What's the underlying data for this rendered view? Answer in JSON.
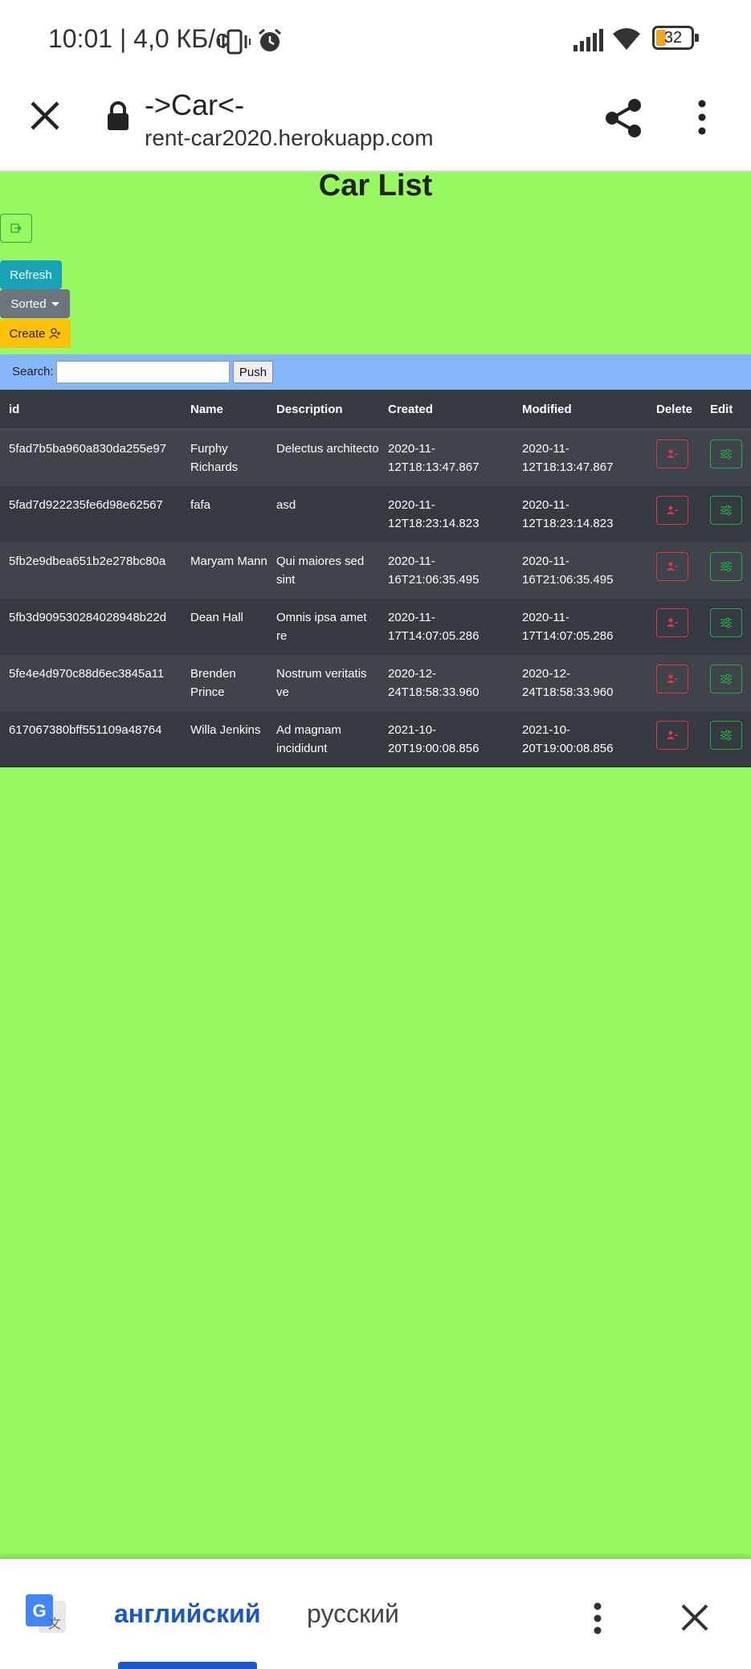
{
  "status_bar": {
    "time": "10:01 | 4,0 КБ/с",
    "battery": "32"
  },
  "browser": {
    "title": "->Car<-",
    "url": "rent-car2020.herokuapp.com"
  },
  "page": {
    "title": "Car List",
    "refresh_label": "Refresh",
    "sorted_label": "Sorted",
    "create_label": "Create"
  },
  "search": {
    "label": "Search:",
    "value": "",
    "push_label": "Push"
  },
  "table": {
    "headers": [
      "id",
      "Name",
      "Description",
      "Created",
      "Modified",
      "Delete",
      "Edit"
    ],
    "rows": [
      {
        "id": "5fad7b5ba960a830da255e97",
        "name": "Furphy Richards",
        "description": "Delectus architecto",
        "created": "2020-11-12T18:13:47.867",
        "modified": "2020-11-12T18:13:47.867"
      },
      {
        "id": "5fad7d922235fe6d98e62567",
        "name": "fafa",
        "description": "asd",
        "created": "2020-11-12T18:23:14.823",
        "modified": "2020-11-12T18:23:14.823"
      },
      {
        "id": "5fb2e9dbea651b2e278bc80a",
        "name": "Maryam Mann",
        "description": "Qui maiores sed sint",
        "created": "2020-11-16T21:06:35.495",
        "modified": "2020-11-16T21:06:35.495"
      },
      {
        "id": "5fb3d909530284028948b22d",
        "name": "Dean Hall",
        "description": "Omnis ipsa amet re",
        "created": "2020-11-17T14:07:05.286",
        "modified": "2020-11-17T14:07:05.286"
      },
      {
        "id": "5fe4e4d970c88d6ec3845a11",
        "name": "Brenden Prince",
        "description": "Nostrum veritatis ve",
        "created": "2020-12-24T18:58:33.960",
        "modified": "2020-12-24T18:58:33.960"
      },
      {
        "id": "617067380bff551109a48764",
        "name": "Willa Jenkins",
        "description": "Ad magnam incididunt",
        "created": "2021-10-20T19:00:08.856",
        "modified": "2021-10-20T19:00:08.856"
      }
    ]
  },
  "translate_bar": {
    "source_lang": "английский",
    "target_lang": "русский"
  },
  "colors": {
    "page_bg": "#98f860",
    "search_bg": "#86b6fa",
    "table_dark": "#343a40",
    "danger": "#dc3545",
    "success": "#28a745",
    "info": "#17a2b8",
    "warning": "#ffc107",
    "secondary": "#6c757d",
    "translate_accent": "#1a56c4"
  }
}
